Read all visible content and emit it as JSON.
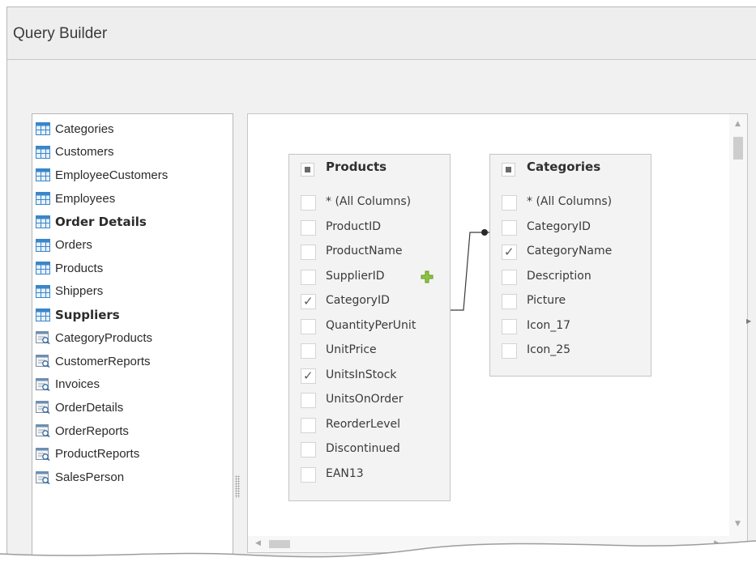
{
  "window": {
    "title": "Query Builder"
  },
  "table_list": {
    "items": [
      {
        "label": "Categories",
        "kind": "table",
        "bold": false
      },
      {
        "label": "Customers",
        "kind": "table",
        "bold": false
      },
      {
        "label": "EmployeeCustomers",
        "kind": "table",
        "bold": false
      },
      {
        "label": "Employees",
        "kind": "table",
        "bold": false
      },
      {
        "label": "Order Details",
        "kind": "table",
        "bold": true
      },
      {
        "label": "Orders",
        "kind": "table",
        "bold": false
      },
      {
        "label": "Products",
        "kind": "table",
        "bold": false
      },
      {
        "label": "Shippers",
        "kind": "table",
        "bold": false
      },
      {
        "label": "Suppliers",
        "kind": "table",
        "bold": true
      },
      {
        "label": "CategoryProducts",
        "kind": "view",
        "bold": false
      },
      {
        "label": "CustomerReports",
        "kind": "view",
        "bold": false
      },
      {
        "label": "Invoices",
        "kind": "view",
        "bold": false
      },
      {
        "label": "OrderDetails",
        "kind": "view",
        "bold": false
      },
      {
        "label": "OrderReports",
        "kind": "view",
        "bold": false
      },
      {
        "label": "ProductReports",
        "kind": "view",
        "bold": false
      },
      {
        "label": "SalesPerson",
        "kind": "view",
        "bold": false
      }
    ]
  },
  "diagram": {
    "entities": [
      {
        "name": "Products",
        "fields": [
          {
            "label": "* (All Columns)",
            "checked": false
          },
          {
            "label": "ProductID",
            "checked": false
          },
          {
            "label": "ProductName",
            "checked": false
          },
          {
            "label": "SupplierID",
            "checked": false
          },
          {
            "label": "CategoryID",
            "checked": true
          },
          {
            "label": "QuantityPerUnit",
            "checked": false
          },
          {
            "label": "UnitPrice",
            "checked": false
          },
          {
            "label": "UnitsInStock",
            "checked": true
          },
          {
            "label": "UnitsOnOrder",
            "checked": false
          },
          {
            "label": "ReorderLevel",
            "checked": false
          },
          {
            "label": "Discontinued",
            "checked": false
          },
          {
            "label": "EAN13",
            "checked": false
          }
        ]
      },
      {
        "name": "Categories",
        "fields": [
          {
            "label": "* (All Columns)",
            "checked": false
          },
          {
            "label": "CategoryID",
            "checked": false
          },
          {
            "label": "CategoryName",
            "checked": true
          },
          {
            "label": "Description",
            "checked": false
          },
          {
            "label": "Picture",
            "checked": false
          },
          {
            "label": "Icon_17",
            "checked": false
          },
          {
            "label": "Icon_25",
            "checked": false
          }
        ]
      }
    ]
  },
  "colors": {
    "table_icon_blue": "#3a86c8",
    "plus_green": "#7cbb3a",
    "view_icon_gray": "#8a8a8a"
  },
  "icons": {
    "table": "table-icon",
    "view": "view-icon",
    "add": "add-relation-icon",
    "check": "✓"
  }
}
